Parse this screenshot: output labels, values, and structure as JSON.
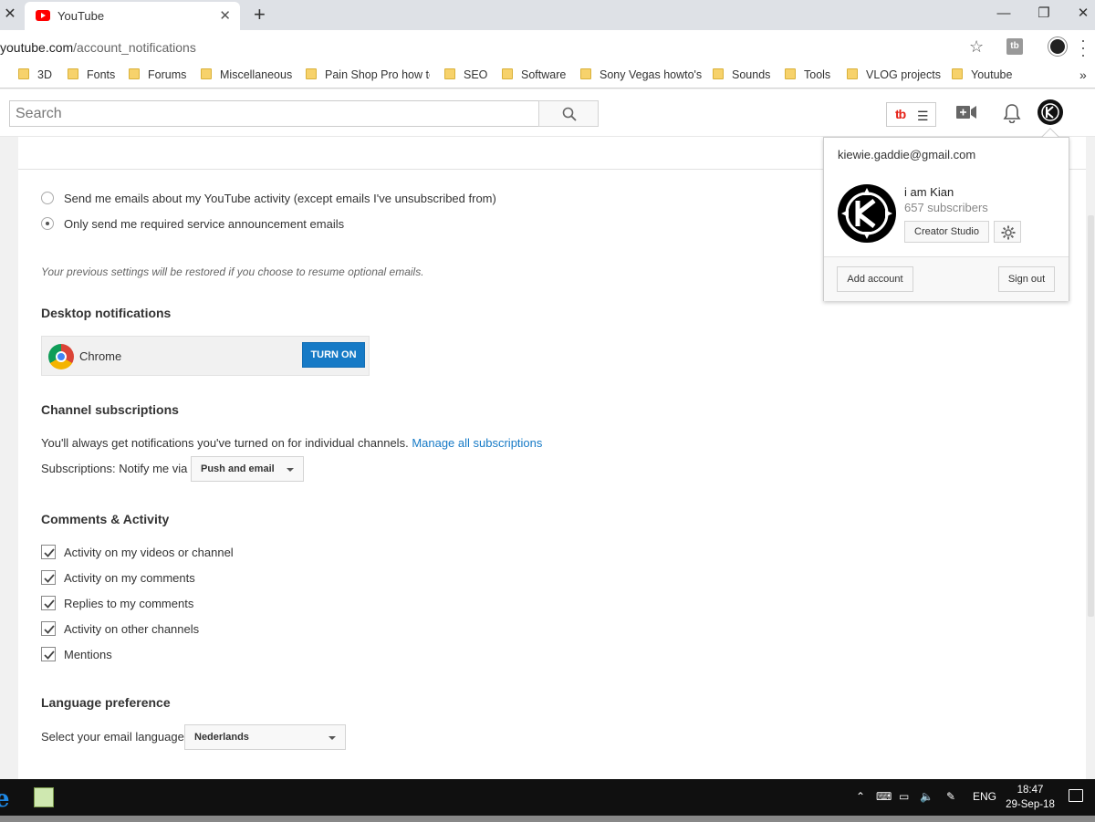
{
  "browser": {
    "tab_title": "YouTube",
    "url_host": "youtube.com",
    "url_path": "/account_notifications",
    "new_tab": "+",
    "bookmarks": [
      "3D",
      "Fonts",
      "Forums",
      "Miscellaneous",
      "Pain Shop Pro how to",
      "SEO",
      "Software",
      "Sony Vegas howto's",
      "Sounds",
      "Tools",
      "VLOG projects",
      "Youtube"
    ]
  },
  "masthead": {
    "search_placeholder": "Search"
  },
  "email": {
    "option_all": "Send me emails about my YouTube activity (except emails I've unsubscribed from)",
    "option_required": "Only send me required service announcement emails",
    "selected": "required",
    "note": "Your previous settings will be restored if you choose to resume optional emails."
  },
  "desktop": {
    "heading": "Desktop notifications",
    "browser_name": "Chrome",
    "turn_on_label": "TURN ON"
  },
  "subscriptions": {
    "heading": "Channel subscriptions",
    "text": "You'll always get notifications you've turned on for individual channels.",
    "link": "Manage all subscriptions",
    "notify_label": "Subscriptions: Notify me via",
    "notify_value": "Push and email"
  },
  "comments": {
    "heading": "Comments & Activity",
    "items": [
      {
        "label": "Activity on my videos or channel",
        "checked": true
      },
      {
        "label": "Activity on my comments",
        "checked": true
      },
      {
        "label": "Replies to my comments",
        "checked": true
      },
      {
        "label": "Activity on other channels",
        "checked": true
      },
      {
        "label": "Mentions",
        "checked": true
      }
    ]
  },
  "language": {
    "heading": "Language preference",
    "label": "Select your email language",
    "value": "Nederlands"
  },
  "account_popup": {
    "email": "kiewie.gaddie@gmail.com",
    "channel_name": "i am Kian",
    "subscribers": "657 subscribers",
    "creator_studio": "Creator Studio",
    "add_account": "Add account",
    "sign_out": "Sign out"
  },
  "taskbar": {
    "language": "ENG",
    "time": "18:47",
    "date": "29-Sep-18"
  },
  "colors": {
    "accent_blue": "#167ac6",
    "youtube_red": "#ff0000"
  }
}
